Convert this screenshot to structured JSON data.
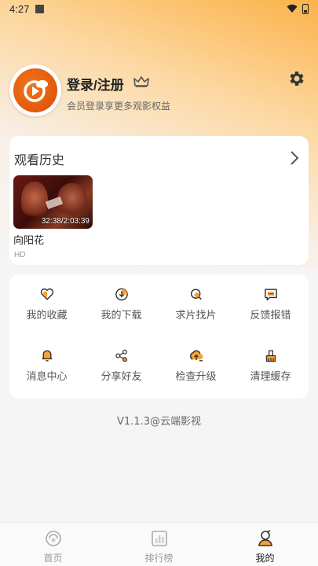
{
  "status_bar": {
    "time": "4:27"
  },
  "profile": {
    "title": "登录/注册",
    "subtitle": "会员登录享更多观影权益"
  },
  "history": {
    "title": "观看历史",
    "items": [
      {
        "name": "向阳花",
        "progress": "32:38/2:03:39",
        "quality": "HD"
      }
    ]
  },
  "menu": {
    "items": [
      {
        "label": "我的收藏",
        "icon": "heart-icon"
      },
      {
        "label": "我的下载",
        "icon": "download-icon"
      },
      {
        "label": "求片找片",
        "icon": "search-film-icon"
      },
      {
        "label": "反馈报错",
        "icon": "feedback-icon"
      },
      {
        "label": "消息中心",
        "icon": "bell-icon"
      },
      {
        "label": "分享好友",
        "icon": "share-icon"
      },
      {
        "label": "检查升级",
        "icon": "upgrade-icon"
      },
      {
        "label": "清理缓存",
        "icon": "clean-icon"
      }
    ]
  },
  "version": "V1.1.3@云端影视",
  "tabbar": {
    "tabs": [
      {
        "label": "首页",
        "active": false
      },
      {
        "label": "排行榜",
        "active": false
      },
      {
        "label": "我的",
        "active": true
      }
    ]
  },
  "colors": {
    "accent": "#f7a233",
    "brand": "#e2580c"
  }
}
